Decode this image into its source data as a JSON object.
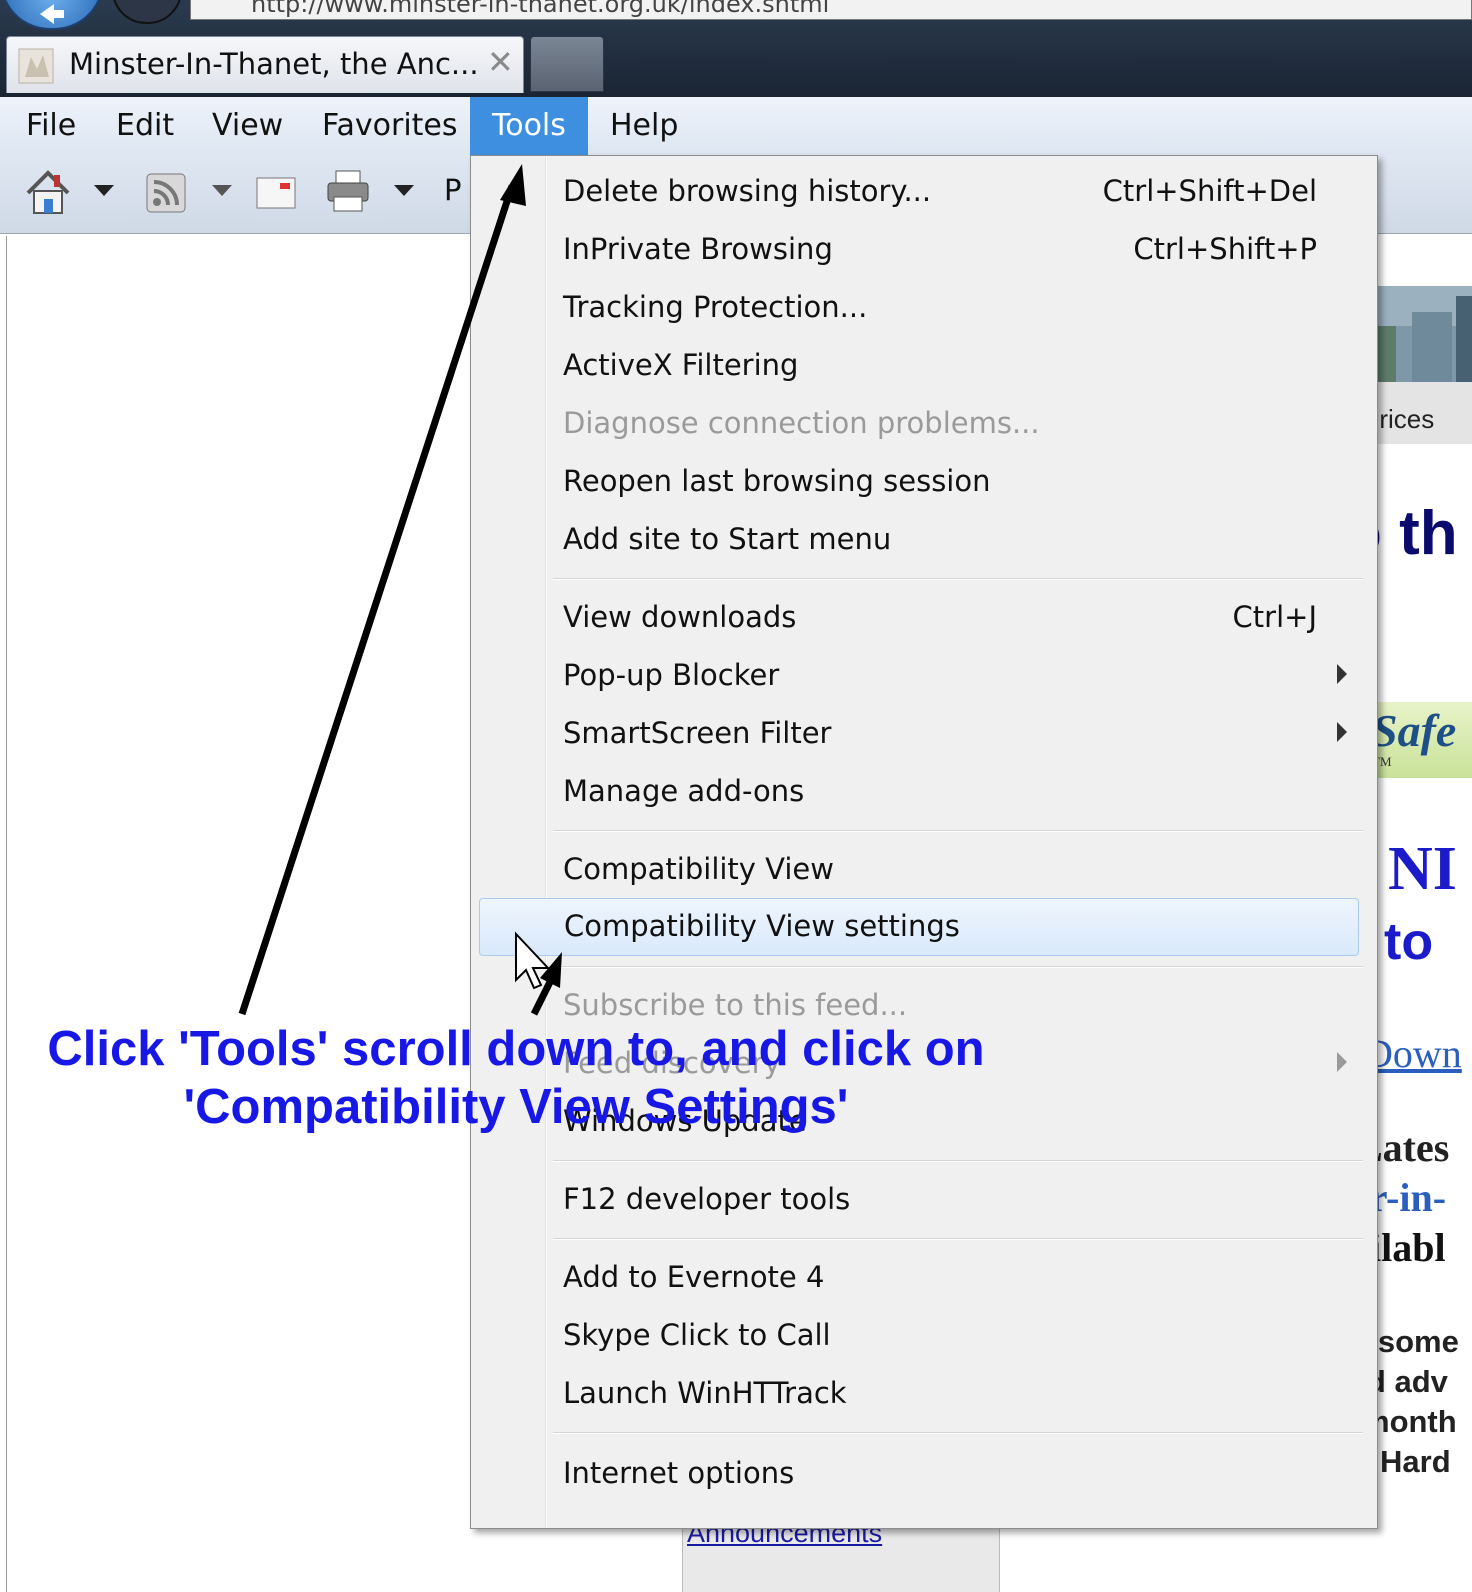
{
  "address_bar": {
    "url": "http://www.minster-in-thanet.org.uk/index.shtml"
  },
  "tab": {
    "title": "Minster-In-Thanet, the Anc...",
    "close_glyph": "✕"
  },
  "menubar": {
    "items": [
      {
        "label": "File"
      },
      {
        "label": "Edit"
      },
      {
        "label": "View"
      },
      {
        "label": "Favorites"
      },
      {
        "label": "Tools"
      },
      {
        "label": "Help"
      }
    ],
    "active": "Tools"
  },
  "toolbar": {
    "page_label": "P"
  },
  "tools_menu": {
    "groups": [
      [
        {
          "label": "Delete browsing history...",
          "shortcut": "Ctrl+Shift+Del"
        },
        {
          "label": "InPrivate Browsing",
          "shortcut": "Ctrl+Shift+P"
        },
        {
          "label": "Tracking Protection..."
        },
        {
          "label": "ActiveX Filtering"
        },
        {
          "label": "Diagnose connection problems...",
          "disabled": true
        },
        {
          "label": "Reopen last browsing session"
        },
        {
          "label": "Add site to Start menu"
        }
      ],
      [
        {
          "label": "View downloads",
          "shortcut": "Ctrl+J"
        },
        {
          "label": "Pop-up Blocker",
          "submenu": true
        },
        {
          "label": "SmartScreen Filter",
          "submenu": true
        },
        {
          "label": "Manage add-ons"
        }
      ],
      [
        {
          "label": "Compatibility View"
        },
        {
          "label": "Compatibility View settings",
          "highlighted": true
        }
      ],
      [
        {
          "label": "Subscribe to this feed...",
          "disabled": true
        },
        {
          "label": "Feed discovery",
          "disabled": true,
          "submenu": true
        },
        {
          "label": "Windows Update"
        }
      ],
      [
        {
          "label": "F12 developer tools"
        }
      ],
      [
        {
          "label": "Add to Evernote 4"
        },
        {
          "label": "Skype Click to Call"
        },
        {
          "label": "Launch WinHTTrack"
        }
      ],
      [
        {
          "label": "Internet options"
        }
      ]
    ]
  },
  "page_fragments": {
    "prices": "Prices",
    "heading_frag": "o th",
    "safe_frag": "Safe",
    "tm_frag": "TM",
    "n_frag": "NI",
    "to_frag": "to",
    "download_frag": "Down",
    "latest_frag": "Lates",
    "er_in_frag": "er-in-",
    "available_frag": "ailabl",
    "some_frag": "e some",
    "adv_frag": "nd adv",
    "month_frag": "month",
    "hard_frag": "Hard",
    "announcements": "Announcements"
  },
  "annotation": {
    "line1": "Click 'Tools' scroll down to, and click on",
    "line2": "'Compatibility View Settings'",
    "color": "#1717e6"
  }
}
